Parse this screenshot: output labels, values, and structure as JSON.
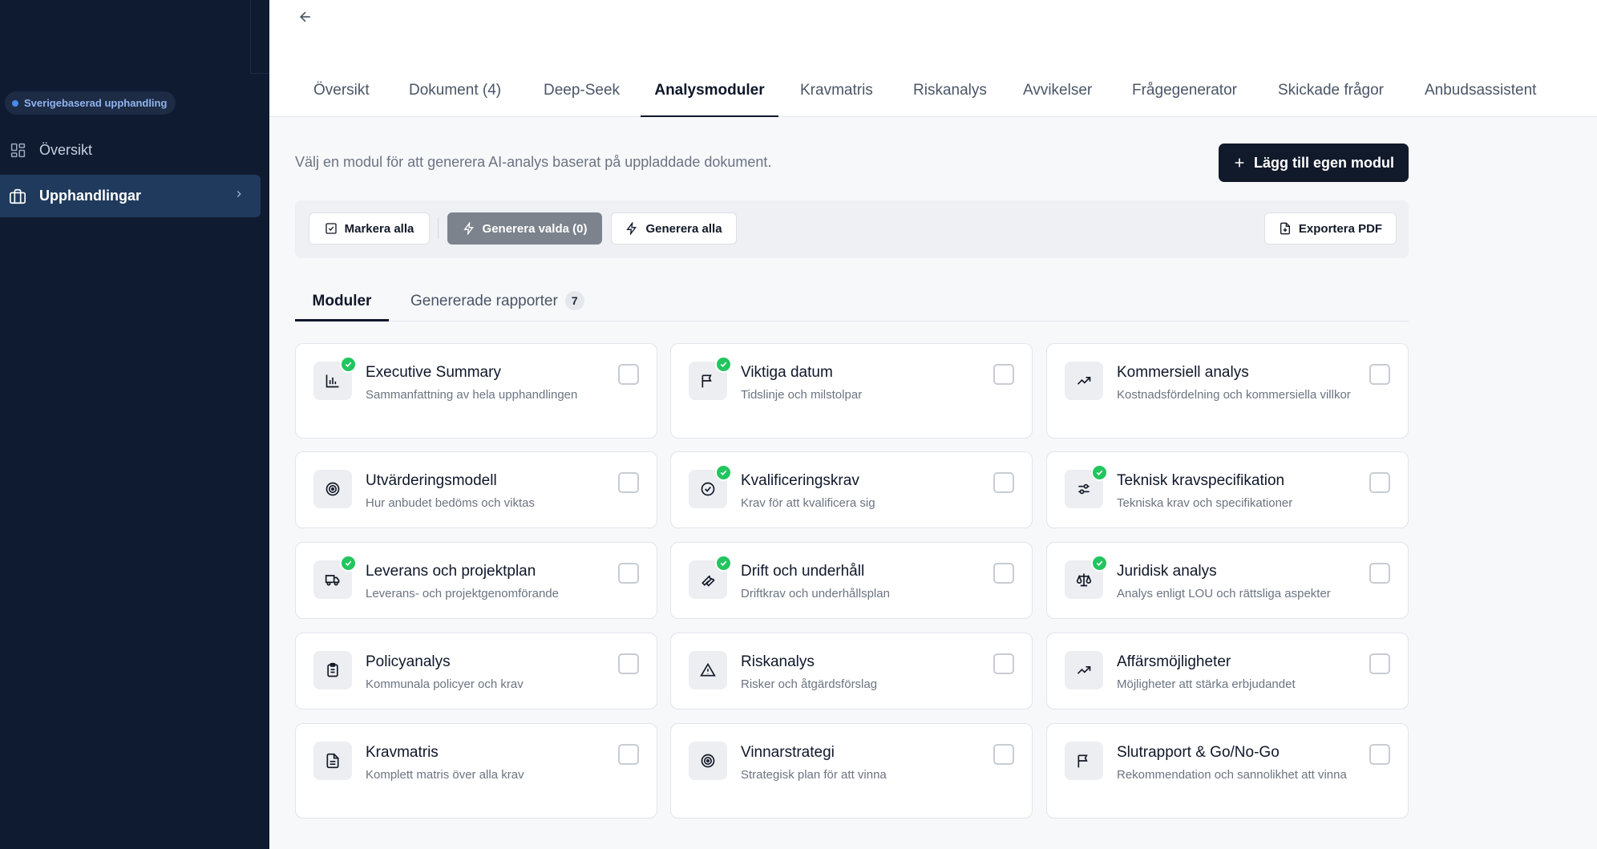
{
  "sidebar": {
    "badge": "Sverigebaserad upphandling",
    "items": [
      {
        "label": "Översikt",
        "icon": "grid-icon"
      },
      {
        "label": "Upphandlingar",
        "icon": "briefcase-icon",
        "active": true
      }
    ]
  },
  "header": {
    "tabs": [
      {
        "label": "Översikt"
      },
      {
        "label": "Dokument (4)"
      },
      {
        "label": "Deep-Seek"
      },
      {
        "label": "Analysmoduler",
        "active": true
      },
      {
        "label": "Kravmatris"
      },
      {
        "label": "Riskanalys"
      },
      {
        "label": "Avvikelser"
      },
      {
        "label": "Frågegenerator"
      },
      {
        "label": "Skickade frågor"
      },
      {
        "label": "Anbudsassistent"
      }
    ]
  },
  "main": {
    "intro": "Välj en modul för att generera AI-analys baserat på uppladdade dokument.",
    "add_button": "Lägg till egen modul",
    "toolbar": {
      "select_all": "Markera alla",
      "generate_selected": "Generera valda (0)",
      "generate_all": "Generera alla",
      "export_pdf": "Exportera PDF"
    },
    "subtabs": {
      "modules": "Moduler",
      "reports": "Genererade rapporter",
      "reports_count": "7"
    },
    "modules": [
      {
        "title": "Executive Summary",
        "desc": "Sammanfattning av hela upphandlingen",
        "icon": "bar-chart-icon",
        "generated": true
      },
      {
        "title": "Viktiga datum",
        "desc": "Tidslinje och milstolpar",
        "icon": "flag-icon",
        "generated": true
      },
      {
        "title": "Kommersiell analys",
        "desc": "Kostnadsfördelning och kommersiella villkor",
        "icon": "trending-up-icon",
        "generated": false
      },
      {
        "title": "Utvärderingsmodell",
        "desc": "Hur anbudet bedöms och viktas",
        "icon": "target-icon",
        "generated": false
      },
      {
        "title": "Kvalificeringskrav",
        "desc": "Krav för att kvalificera sig",
        "icon": "check-circle-icon",
        "generated": true
      },
      {
        "title": "Teknisk kravspecifikation",
        "desc": "Tekniska krav och specifikationer",
        "icon": "settings-sliders-icon",
        "generated": true
      },
      {
        "title": "Leverans och projektplan",
        "desc": "Leverans- och projektgenomförande",
        "icon": "truck-icon",
        "generated": true
      },
      {
        "title": "Drift och underhåll",
        "desc": "Driftkrav och underhållsplan",
        "icon": "wrench-icon",
        "generated": true
      },
      {
        "title": "Juridisk analys",
        "desc": "Analys enligt LOU och rättsliga aspekter",
        "icon": "scale-icon",
        "generated": true
      },
      {
        "title": "Policyanalys",
        "desc": "Kommunala policyer och krav",
        "icon": "clipboard-icon",
        "generated": false
      },
      {
        "title": "Riskanalys",
        "desc": "Risker och åtgärdsförslag",
        "icon": "warning-icon",
        "generated": false
      },
      {
        "title": "Affärsmöjligheter",
        "desc": "Möjligheter att stärka erbjudandet",
        "icon": "trending-up-icon",
        "generated": false
      },
      {
        "title": "Kravmatris",
        "desc": "Komplett matris över alla krav",
        "icon": "document-icon",
        "generated": false
      },
      {
        "title": "Vinnarstrategi",
        "desc": "Strategisk plan för att vinna",
        "icon": "target-icon",
        "generated": false
      },
      {
        "title": "Slutrapport & Go/No-Go",
        "desc": "Rekommendation och sannolikhet att vinna",
        "icon": "flag-icon",
        "generated": false
      }
    ]
  },
  "colors": {
    "sidebar_bg": "#0f1b31",
    "primary_button": "#111a2b",
    "success": "#22c55e",
    "active_nav": "#1f3a5c"
  }
}
